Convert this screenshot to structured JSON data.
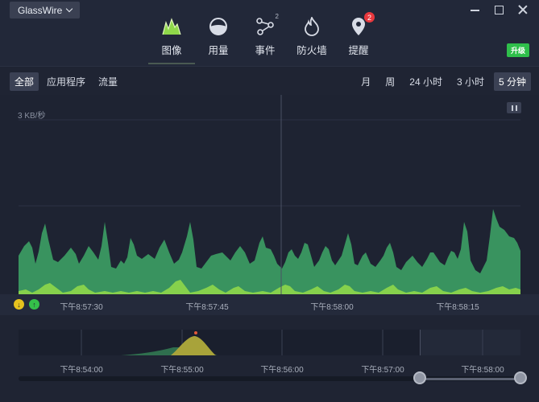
{
  "app": {
    "name": "GlassWire"
  },
  "nav": {
    "tabs": [
      {
        "label": "图像",
        "icon": "graph-icon",
        "active": true
      },
      {
        "label": "用量",
        "icon": "usage-icon"
      },
      {
        "label": "事件",
        "icon": "events-icon",
        "sup": "2"
      },
      {
        "label": "防火墙",
        "icon": "firewall-icon"
      },
      {
        "label": "提醒",
        "icon": "alert-icon",
        "badge": "2"
      }
    ],
    "upgrade_label": "升级"
  },
  "filters": {
    "items": [
      "全部",
      "应用程序",
      "流量"
    ],
    "selected": "全部"
  },
  "ranges": {
    "items": [
      "月",
      "周",
      "24 小时",
      "3 小时",
      "5 分钟"
    ],
    "selected": "5 分钟"
  },
  "graph": {
    "y_label": "3 KB/秒",
    "time_ticks": [
      "下午8:57:30",
      "下午8:57:45",
      "下午8:58:00",
      "下午8:58:15"
    ]
  },
  "overview": {
    "time_ticks": [
      "下午8:54:00",
      "下午8:55:00",
      "下午8:56:00",
      "下午8:57:00",
      "下午8:58:00"
    ]
  },
  "colors": {
    "incoming": "#3b9a62",
    "outgoing": "#8fd84a",
    "accent": "#2fbf4b",
    "badge": "#e8383d"
  }
}
